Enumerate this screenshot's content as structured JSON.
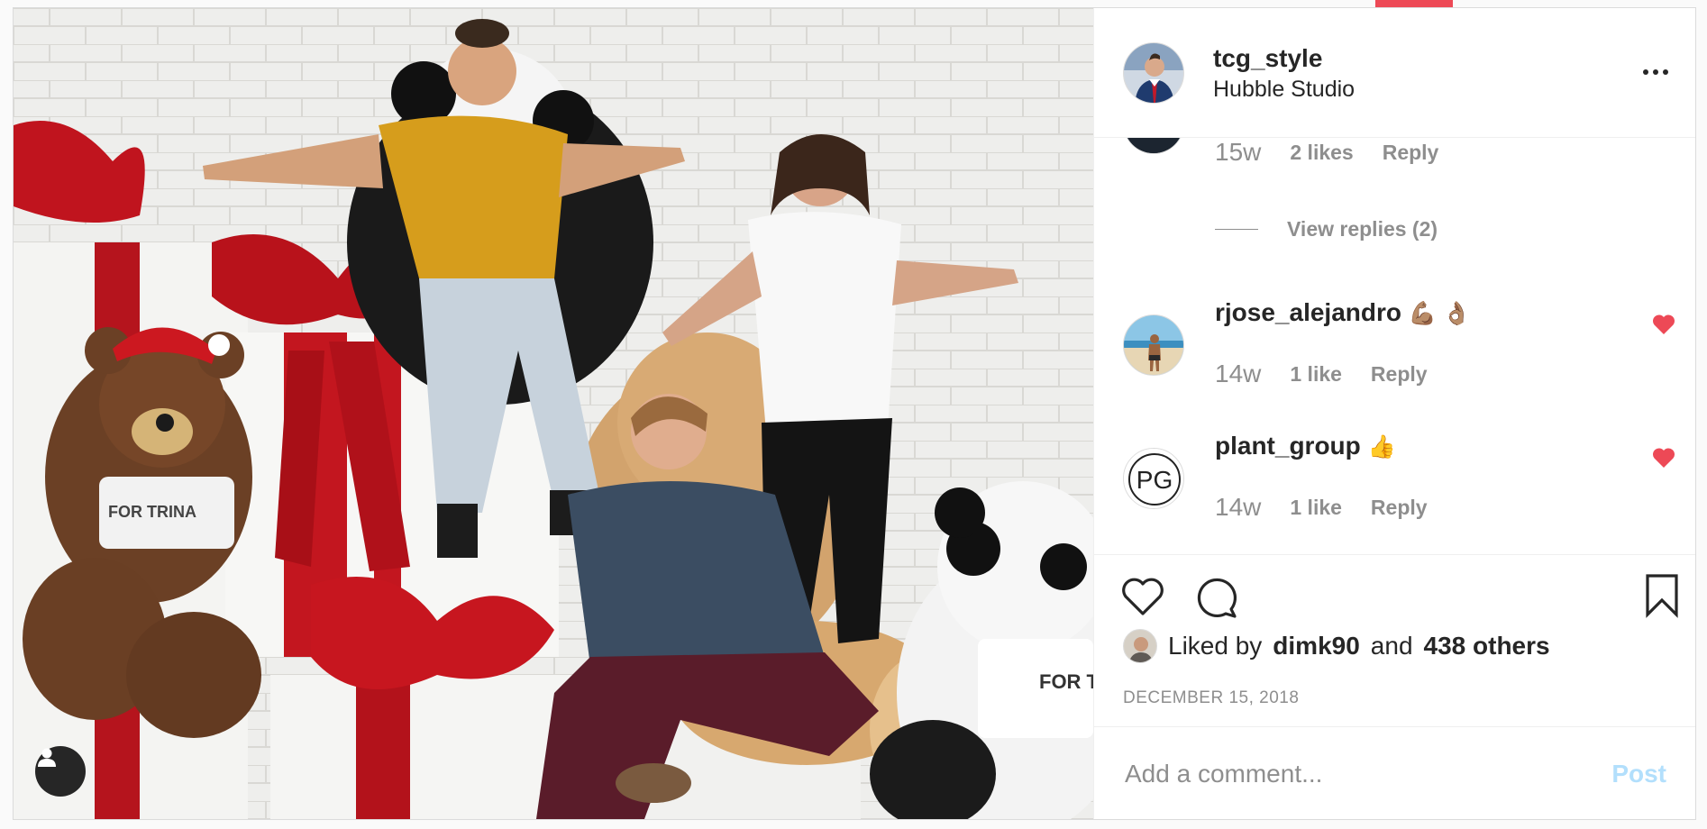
{
  "post": {
    "owner": {
      "username": "tcg_style",
      "location": "Hubble Studio"
    },
    "photo_caption_tag": "FOR TRINA",
    "photo_caption_tag2": "FOR T",
    "comments_top": {
      "time": "15w",
      "likes": "2 likes",
      "reply": "Reply",
      "view_replies": "View replies (2)"
    },
    "comments": [
      {
        "author": "rjose_alejandro",
        "emoji": "💪🏽 👌🏽",
        "time": "14w",
        "likes": "1 like",
        "reply": "Reply",
        "liked": true
      },
      {
        "author": "plant_group",
        "emoji": "👍",
        "time": "14w",
        "likes": "1 like",
        "reply": "Reply",
        "liked": true
      }
    ],
    "liked_by": {
      "prefix": "Liked by",
      "user": "dimk90",
      "connector": "and",
      "others": "438 others"
    },
    "date": "DECEMBER 15, 2018",
    "comment_box": {
      "placeholder": "Add a comment...",
      "post_label": "Post"
    },
    "avatar_initials_pg": "PG"
  },
  "colors": {
    "heart": "#ed4956",
    "post_disabled": "#b2dffc",
    "muted": "#8e8e8e",
    "text": "#262626"
  },
  "icons": [
    "user-tag-icon",
    "more-icon",
    "heart-icon",
    "comment-icon",
    "bookmark-icon"
  ]
}
